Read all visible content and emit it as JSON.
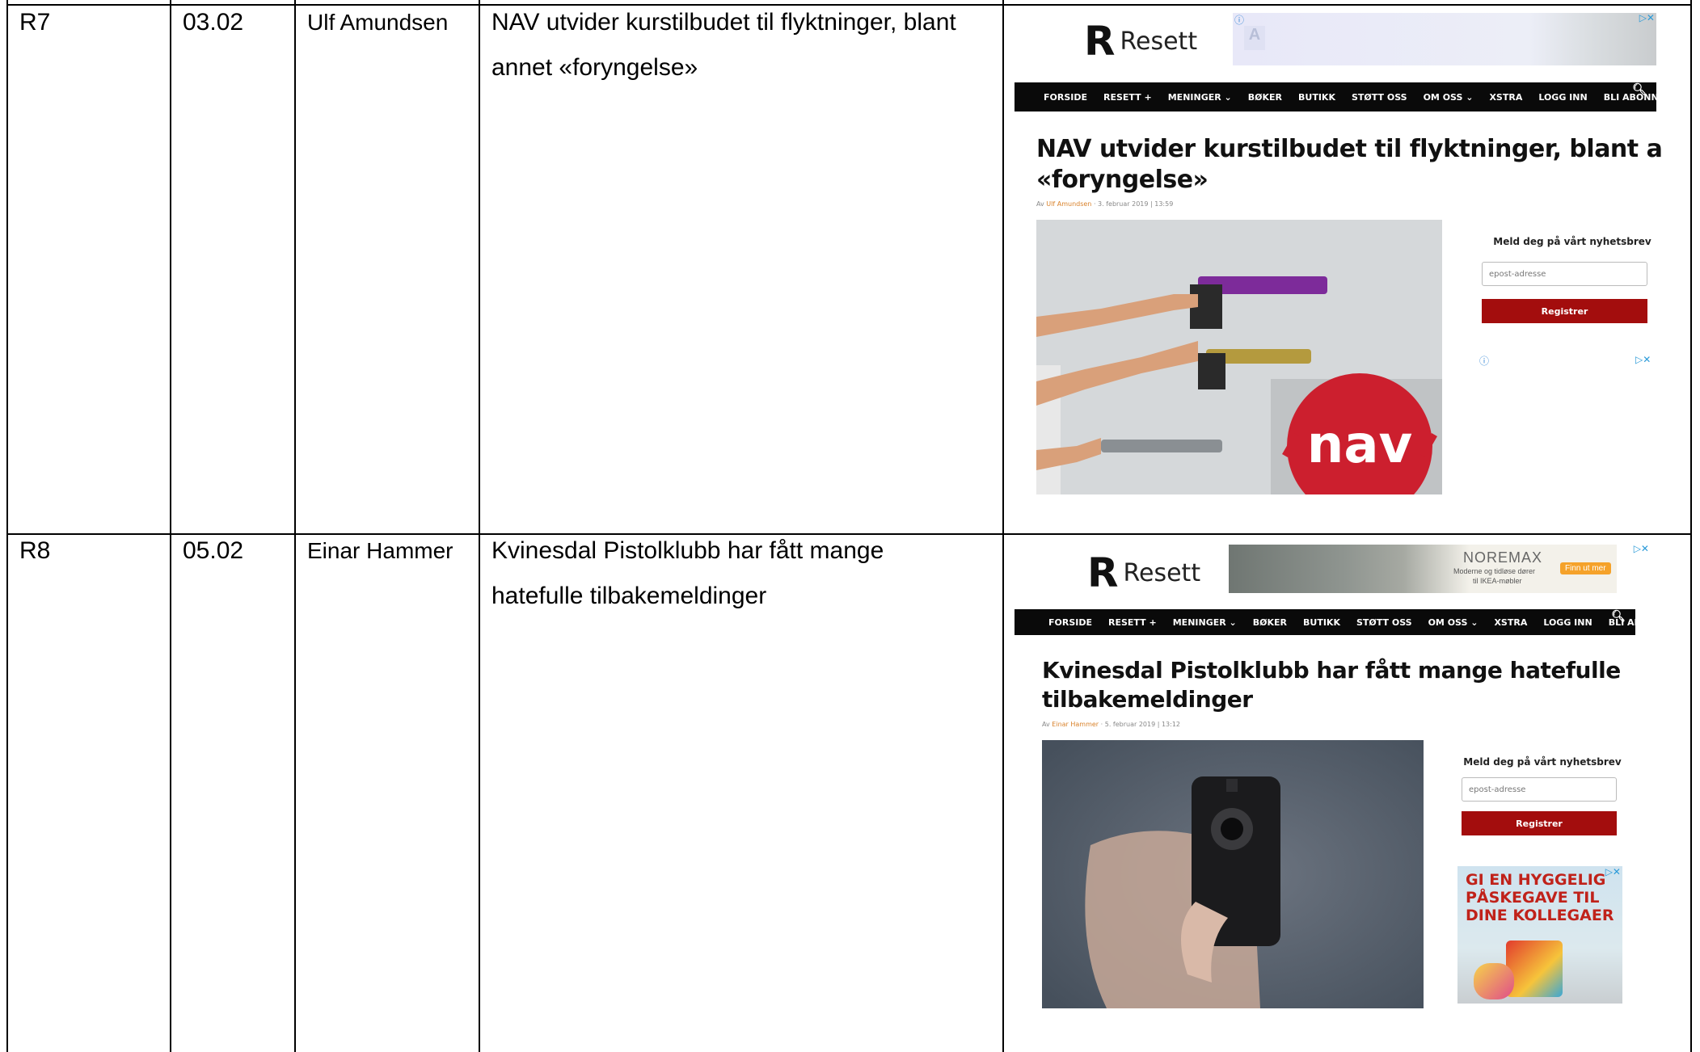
{
  "rows": [
    {
      "id": "R7",
      "date": "03.02",
      "author": "Ulf Amundsen",
      "title_line1": "NAV utvider kurstilbudet til flyktninger, blant",
      "title_line2": "annet «foryngelse»",
      "screenshot": {
        "logo_text": "Resett",
        "nav_items": [
          "FORSIDE",
          "RESETT +",
          "MENINGER ⌄",
          "BØKER",
          "BUTIKK",
          "STØTT OSS",
          "OM OSS ⌄",
          "XSTRA",
          "LOGG INN",
          "BLI ABONNENT"
        ],
        "headline_line1": "NAV utvider kurstilbudet til flyktninger, blant annet",
        "headline_line2": "«foryngelse»",
        "byline_prefix": "Av",
        "byline_author": "Ulf Amundsen",
        "byline_date": "· 3. februar 2019 | 13:59",
        "newsletter_title": "Meld deg på vårt nyhetsbrev",
        "email_placeholder": "epost-adresse",
        "register_label": "Registrer",
        "photo_logo": "nav"
      }
    },
    {
      "id": "R8",
      "date": "05.02",
      "author": "Einar Hammer",
      "title_line1": "Kvinesdal Pistolklubb har fått mange",
      "title_line2": "hatefulle tilbakemeldinger",
      "screenshot": {
        "logo_text": "Resett",
        "ad_brand": "NOREMAX",
        "ad_line1": "Moderne og tidløse dører",
        "ad_line2": "til IKEA-møbler",
        "ad_cta": "Finn ut mer",
        "nav_items": [
          "FORSIDE",
          "RESETT +",
          "MENINGER ⌄",
          "BØKER",
          "BUTIKK",
          "STØTT OSS",
          "OM OSS ⌄",
          "XSTRA",
          "LOGG INN",
          "BLI ABONNENT"
        ],
        "headline_line1": "Kvinesdal Pistolklubb har fått mange hatefulle",
        "headline_line2": "tilbakemeldinger",
        "byline_prefix": "Av",
        "byline_author": "Einar Hammer",
        "byline_date": "· 5. februar 2019 | 13:12",
        "newsletter_title": "Meld deg på vårt nyhetsbrev",
        "email_placeholder": "epost-adresse",
        "register_label": "Registrer",
        "side_ad_text": "GI EN HYGGELIG PÅSKEGAVE TIL DINE KOLLEGAER"
      }
    }
  ]
}
